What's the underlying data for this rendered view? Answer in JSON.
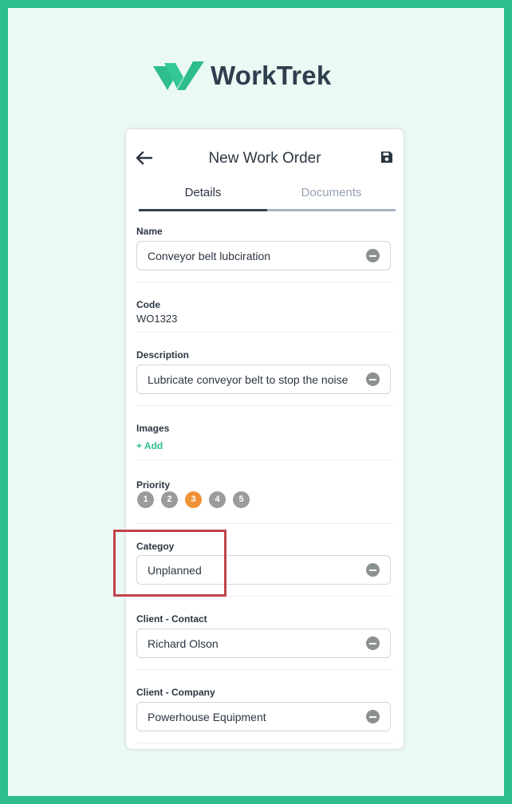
{
  "brand": {
    "name": "WorkTrek",
    "color": "#2dbd8f"
  },
  "header": {
    "title": "New Work Order",
    "back_icon": "arrow-left-icon",
    "save_icon": "floppy-disk-icon"
  },
  "tabs": [
    {
      "label": "Details",
      "active": true
    },
    {
      "label": "Documents",
      "active": false
    }
  ],
  "form": {
    "name": {
      "label": "Name",
      "value": "Conveyor belt lubciration"
    },
    "code": {
      "label": "Code",
      "value": "WO1323"
    },
    "description": {
      "label": "Description",
      "value": "Lubricate conveyor belt to stop the noise"
    },
    "images": {
      "label": "Images",
      "add_label": "+ Add"
    },
    "priority": {
      "label": "Priority",
      "options": [
        "1",
        "2",
        "3",
        "4",
        "5"
      ],
      "selected": "3"
    },
    "category": {
      "label": "Categoy",
      "value": "Unplanned"
    },
    "client_contact": {
      "label": "Client - Contact",
      "value": "Richard Olson"
    },
    "client_company": {
      "label": "Client - Company",
      "value": "Powerhouse Equipment"
    }
  },
  "colors": {
    "accent": "#2dbd8f",
    "priority_selected": "#ef9235",
    "highlight": "#c2434a"
  }
}
